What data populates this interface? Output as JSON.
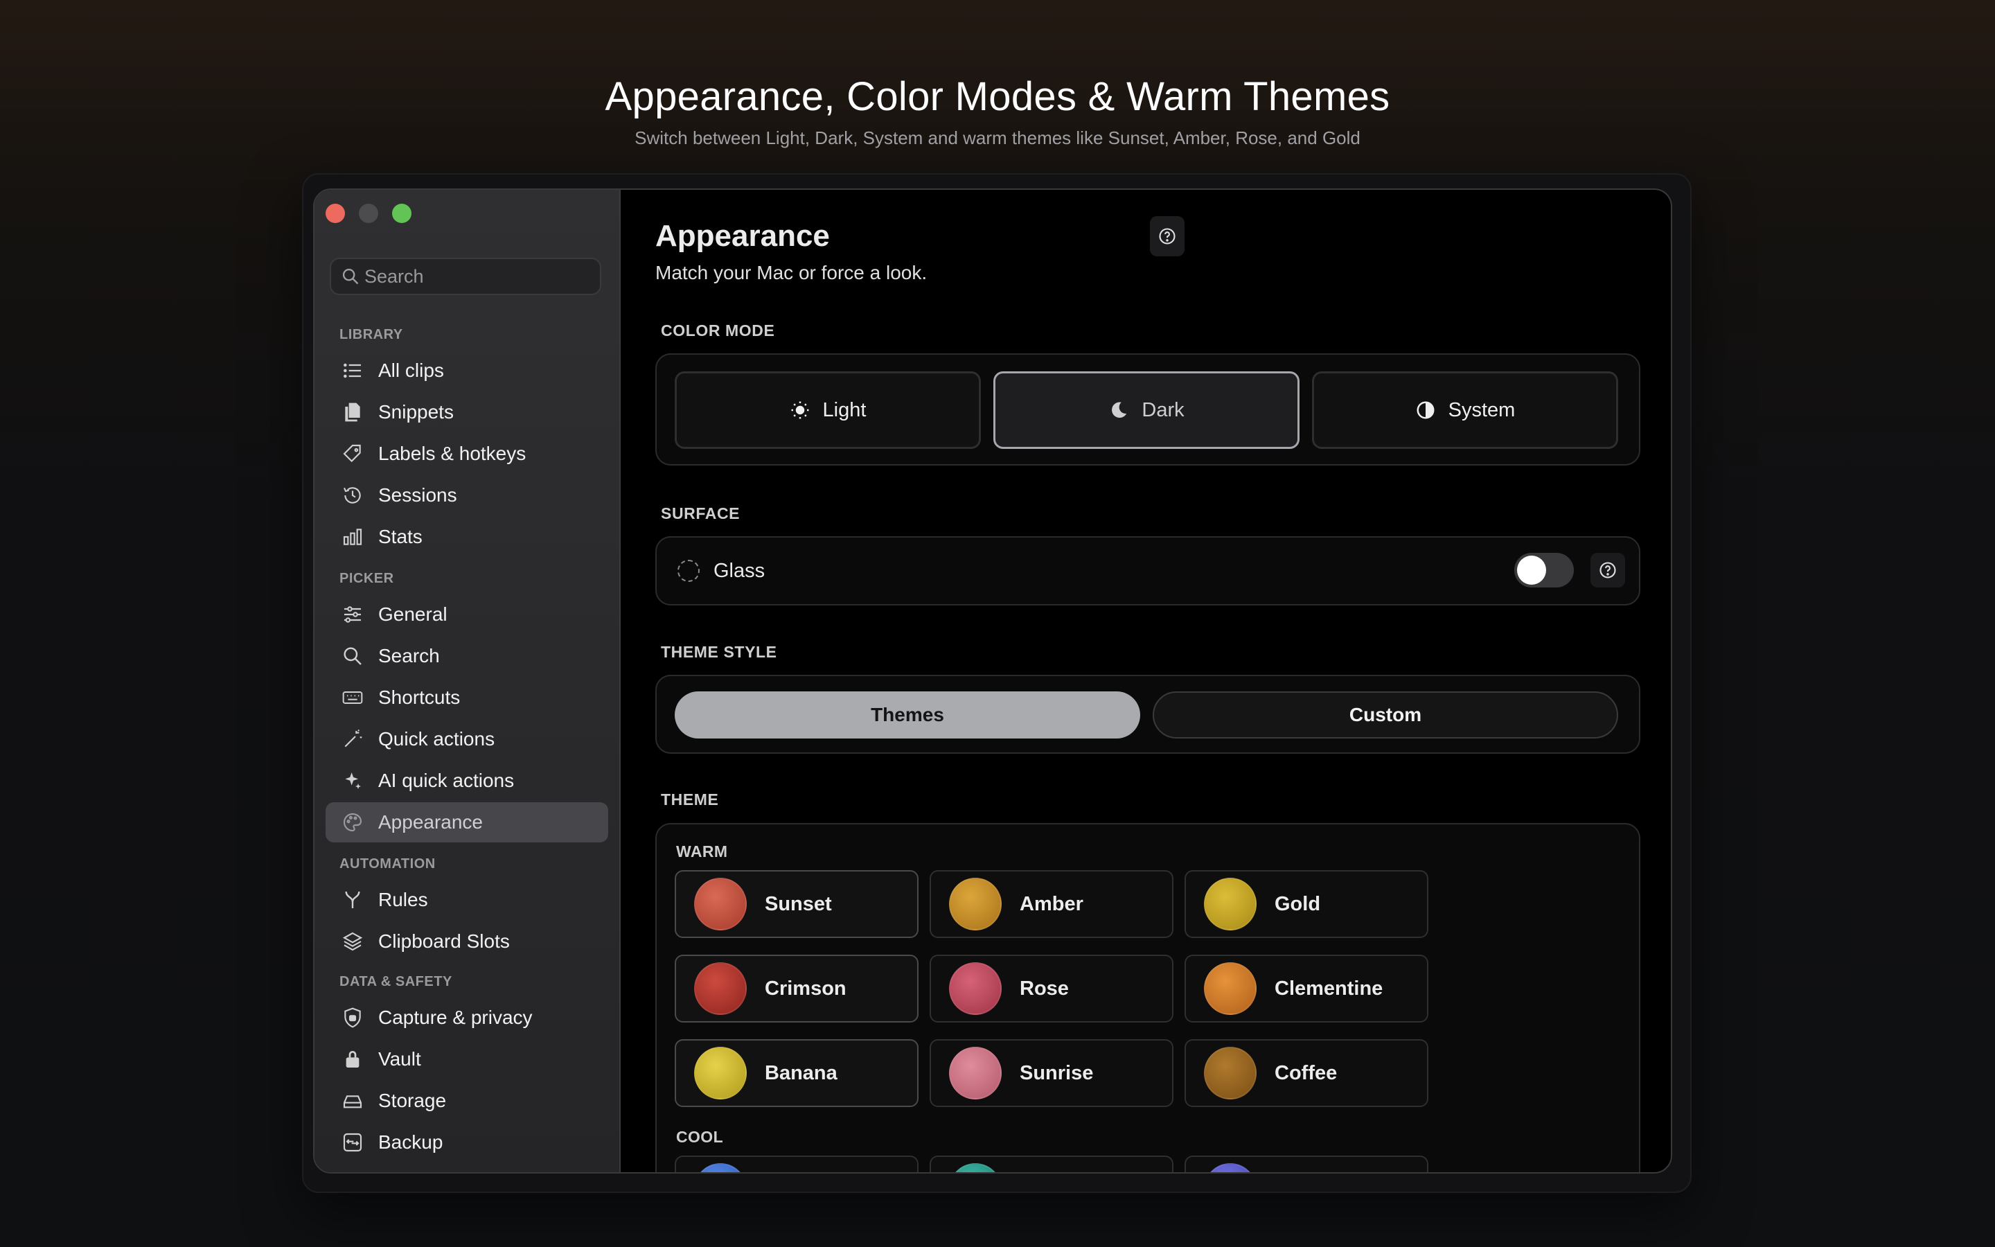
{
  "hero": {
    "title": "Appearance, Color Modes & Warm Themes",
    "subtitle": "Switch between Light, Dark, System and warm themes like Sunset, Amber, Rose, and Gold"
  },
  "search": {
    "placeholder": "Search",
    "value": ""
  },
  "sidebar": {
    "sections": {
      "library": "LIBRARY",
      "picker": "PICKER",
      "automation": "AUTOMATION",
      "data_safety": "DATA & SAFETY"
    },
    "items": [
      {
        "label": "All clips",
        "icon": "list-icon"
      },
      {
        "label": "Snippets",
        "icon": "documents-icon"
      },
      {
        "label": "Labels & hotkeys",
        "icon": "tag-icon"
      },
      {
        "label": "Sessions",
        "icon": "history-icon"
      },
      {
        "label": "Stats",
        "icon": "bar-chart-icon"
      },
      {
        "label": "General",
        "icon": "sliders-icon"
      },
      {
        "label": "Search",
        "icon": "search-icon"
      },
      {
        "label": "Shortcuts",
        "icon": "keyboard-icon"
      },
      {
        "label": "Quick actions",
        "icon": "magic-wand-icon"
      },
      {
        "label": "AI quick actions",
        "icon": "sparkles-icon"
      },
      {
        "label": "Appearance",
        "icon": "palette-icon",
        "active": true
      },
      {
        "label": "Rules",
        "icon": "fork-icon"
      },
      {
        "label": "Clipboard Slots",
        "icon": "layers-icon"
      },
      {
        "label": "Capture & privacy",
        "icon": "shield-icon"
      },
      {
        "label": "Vault",
        "icon": "lock-icon"
      },
      {
        "label": "Storage",
        "icon": "drive-icon"
      },
      {
        "label": "Backup",
        "icon": "backup-icon"
      }
    ]
  },
  "main": {
    "title": "Appearance",
    "subtitle": "Match your Mac or force a look.",
    "color_mode": {
      "label": "COLOR MODE",
      "options": [
        "Light",
        "Dark",
        "System"
      ],
      "selected": "Dark"
    },
    "surface": {
      "label": "SURFACE",
      "glass_label": "Glass",
      "glass_enabled": false
    },
    "theme_style": {
      "label": "THEME STYLE",
      "options": [
        "Themes",
        "Custom"
      ],
      "selected": "Themes"
    },
    "theme": {
      "label": "THEME",
      "warm_label": "WARM",
      "cool_label": "COOL",
      "warm": [
        {
          "name": "Sunset",
          "color": "#c4503e"
        },
        {
          "name": "Amber",
          "color": "#c98f24"
        },
        {
          "name": "Gold",
          "color": "#c9a920"
        },
        {
          "name": "Crimson",
          "color": "#b6332b"
        },
        {
          "name": "Rose",
          "color": "#c24a5e"
        },
        {
          "name": "Clementine",
          "color": "#d27a24"
        },
        {
          "name": "Banana",
          "color": "#d2be2c"
        },
        {
          "name": "Sunrise",
          "color": "#d07286"
        },
        {
          "name": "Coffee",
          "color": "#9a6520"
        }
      ],
      "cool": [
        {
          "color": "#3b6fd6"
        },
        {
          "color": "#2a9e8c"
        },
        {
          "color": "#5858d0"
        }
      ]
    }
  },
  "colors": {
    "accent_caret": "#3b82f6",
    "close": "#ed6a5e",
    "maximize": "#61c454"
  }
}
